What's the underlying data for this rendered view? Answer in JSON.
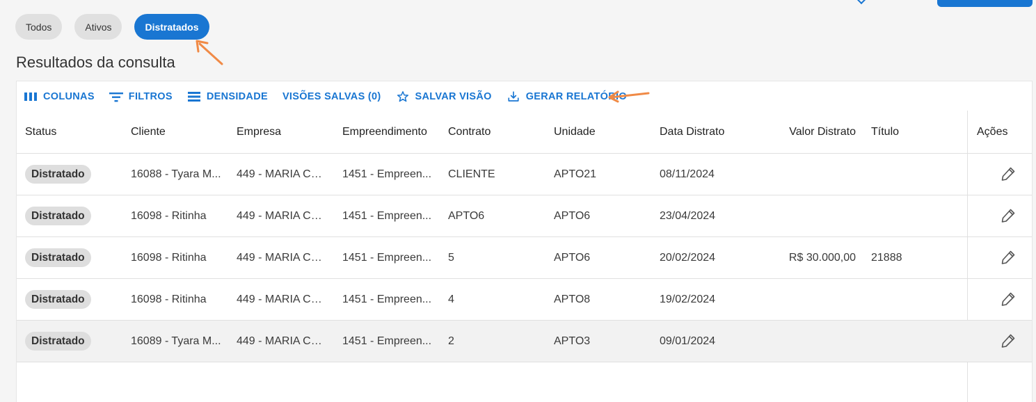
{
  "filters": {
    "chips": [
      {
        "label": "Todos",
        "active": false
      },
      {
        "label": "Ativos",
        "active": false
      },
      {
        "label": "Distratados",
        "active": true
      }
    ]
  },
  "page": {
    "title": "Resultados da consulta"
  },
  "toolbar": {
    "columns": "COLUNAS",
    "filters": "FILTROS",
    "density": "DENSIDADE",
    "saved_views": "VISÕES SALVAS (0)",
    "save_view": "SALVAR VISÃO",
    "report": "GERAR RELATÓRIO"
  },
  "table": {
    "headers": {
      "status": "Status",
      "cliente": "Cliente",
      "empresa": "Empresa",
      "empreendimento": "Empreendimento",
      "contrato": "Contrato",
      "unidade": "Unidade",
      "data_distrato": "Data Distrato",
      "valor_distrato": "Valor Distrato",
      "titulo": "Título",
      "acoes": "Ações"
    },
    "rows": [
      {
        "status": "Distratado",
        "cliente": "16088 - Tyara M...",
        "empresa": "449 - MARIA CO...",
        "empreendimento": "1451 - Empreen...",
        "contrato": "CLIENTE",
        "unidade": "APTO21",
        "data_distrato": "08/11/2024",
        "valor_distrato": "",
        "titulo": ""
      },
      {
        "status": "Distratado",
        "cliente": "16098 - Ritinha",
        "empresa": "449 - MARIA CO...",
        "empreendimento": "1451 - Empreen...",
        "contrato": "APTO6",
        "unidade": "APTO6",
        "data_distrato": "23/04/2024",
        "valor_distrato": "",
        "titulo": ""
      },
      {
        "status": "Distratado",
        "cliente": "16098 - Ritinha",
        "empresa": "449 - MARIA CO...",
        "empreendimento": "1451 - Empreen...",
        "contrato": "5",
        "unidade": "APTO6",
        "data_distrato": "20/02/2024",
        "valor_distrato": "R$ 30.000,00",
        "titulo": "21888"
      },
      {
        "status": "Distratado",
        "cliente": "16098 - Ritinha",
        "empresa": "449 - MARIA CO...",
        "empreendimento": "1451 - Empreen...",
        "contrato": "4",
        "unidade": "APTO8",
        "data_distrato": "19/02/2024",
        "valor_distrato": "",
        "titulo": ""
      },
      {
        "status": "Distratado",
        "cliente": "16089 - Tyara M...",
        "empresa": "449 - MARIA CO...",
        "empreendimento": "1451 - Empreen...",
        "contrato": "2",
        "unidade": "APTO3",
        "data_distrato": "09/01/2024",
        "valor_distrato": "",
        "titulo": ""
      }
    ]
  },
  "colors": {
    "accent": "#1976d2",
    "annotation_arrow": "#f08a46",
    "badge_bg": "#dedede"
  },
  "icons": [
    "columns-icon",
    "filter-icon",
    "density-icon",
    "star-icon",
    "download-icon",
    "pencil-icon"
  ]
}
